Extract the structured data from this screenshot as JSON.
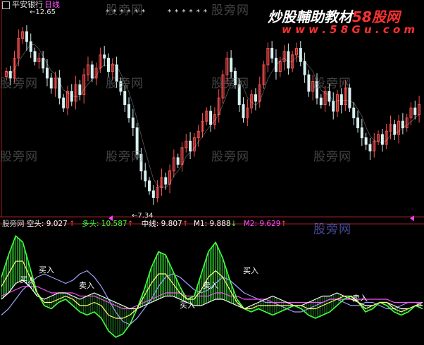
{
  "header": {
    "stock": "平安银行",
    "period": "日线",
    "high_label": "12.65",
    "low_label": "7.34",
    "stars": "* * * * * *"
  },
  "watermarks": {
    "text": "股旁网"
  },
  "branding": {
    "slogan": "炒股輔助教材",
    "site": "58股网",
    "url": "w w w . 5 8 G u . c o m"
  },
  "indicator": {
    "name": "股旁网",
    "kong_label": "空头:",
    "kong_value": "9.027",
    "duo_label": "多头:",
    "duo_value": "10.587",
    "mid_label": "中线:",
    "mid_value": "9.807",
    "m1_label": "M1:",
    "m1_value": "9.888",
    "m2_label": "M2:",
    "m2_value": "9.629",
    "signal_buy": "买入",
    "signal_sell": "卖入"
  },
  "colors": {
    "background": "#000000",
    "candle_up": "#ff5050",
    "candle_down": "#d8f0f0",
    "ma": "#ffffff",
    "kong": "#ffffff",
    "duo": "#40ff40",
    "mid": "#ffff80",
    "m1": "#a0a0ff",
    "m2": "#ff50ff",
    "duo_bar": "#40ff40",
    "axis": "#a02020"
  },
  "chart_data": [
    {
      "type": "candlestick",
      "title": "平安银行 日线",
      "annotations": [
        {
          "text": "12.65",
          "index": 3,
          "value": 12.65
        },
        {
          "text": "7.34",
          "index": 36,
          "value": 7.34
        }
      ],
      "ylim": [
        6.9,
        13.1
      ],
      "series": [
        {
          "values": [
            11.2,
            11.0,
            11.6,
            12.2,
            12.4,
            12.1,
            11.8,
            11.5,
            11.6,
            11.3,
            11.0,
            10.7,
            11.0,
            10.4,
            10.1,
            10.6,
            10.3,
            10.8,
            10.5,
            11.1,
            11.4,
            11.0,
            11.3,
            11.7,
            11.6,
            11.2,
            11.4,
            10.9,
            10.6,
            10.2,
            9.8,
            9.5,
            8.7,
            8.2,
            7.9,
            7.6,
            7.4,
            7.7,
            8.0,
            7.8,
            8.2,
            8.6,
            8.4,
            8.9,
            9.1,
            8.8,
            9.2,
            9.4,
            9.7,
            10.0,
            9.6,
            9.9,
            10.4,
            11.1,
            11.6,
            11.2,
            10.8,
            10.2,
            9.8,
            10.1,
            10.5,
            10.3,
            10.8,
            11.4,
            11.9,
            11.6,
            11.2,
            11.5,
            11.8,
            11.3,
            11.7,
            11.9,
            11.5,
            11.1,
            10.6,
            10.9,
            10.4,
            10.2,
            10.6,
            10.3,
            10.0,
            10.5,
            10.2,
            10.7,
            10.1,
            9.8,
            9.5,
            9.2,
            9.0,
            8.8,
            9.1,
            9.3,
            9.0,
            9.4,
            9.6,
            9.3,
            9.7,
            9.5,
            9.8,
            10.1,
            9.9,
            10.2
          ]
        }
      ]
    },
    {
      "type": "line",
      "ylim": [
        8.0,
        11.6
      ],
      "series": [
        {
          "name": "空头",
          "values": [
            9.4,
            9.6,
            9.9,
            10.0,
            9.8,
            9.5,
            9.4,
            9.5,
            9.6,
            9.6,
            9.5,
            9.4,
            9.5,
            9.6,
            9.5,
            9.4,
            9.3,
            9.2,
            9.1,
            9.1,
            9.2,
            9.3,
            9.4,
            9.5,
            9.5,
            9.4,
            9.3,
            9.2,
            9.2,
            9.3,
            9.4,
            9.4,
            9.3,
            9.2,
            9.1,
            9.2,
            9.3,
            9.4,
            9.5,
            9.4,
            9.3,
            9.2,
            9.2,
            9.3,
            9.4,
            9.5,
            9.5,
            9.6,
            9.5,
            9.4,
            9.3,
            9.2,
            9.2,
            9.3,
            9.3,
            9.2,
            9.1,
            9.1,
            9.2,
            9.3
          ]
        },
        {
          "name": "多头",
          "values": [
            10.1,
            10.8,
            11.4,
            11.2,
            10.4,
            9.6,
            9.2,
            9.1,
            9.3,
            9.4,
            9.2,
            9.0,
            8.9,
            9.0,
            8.8,
            8.4,
            8.2,
            8.3,
            8.6,
            9.1,
            9.7,
            10.4,
            10.9,
            10.8,
            10.3,
            9.8,
            9.4,
            9.5,
            10.2,
            10.9,
            11.2,
            10.7,
            10.0,
            9.4,
            9.1,
            9.0,
            9.1,
            9.0,
            8.9,
            9.0,
            9.1,
            9.2,
            9.1,
            8.9,
            8.8,
            8.9,
            9.0,
            9.2,
            9.4,
            9.5,
            9.3,
            9.0,
            9.1,
            9.3,
            9.2,
            9.0,
            8.9,
            9.0,
            9.2,
            9.1
          ]
        },
        {
          "name": "中线",
          "values": [
            9.8,
            10.2,
            10.6,
            10.6,
            10.1,
            9.6,
            9.3,
            9.3,
            9.4,
            9.5,
            9.4,
            9.2,
            9.2,
            9.3,
            9.2,
            8.9,
            8.8,
            8.8,
            8.9,
            9.1,
            9.5,
            9.9,
            10.2,
            10.2,
            9.9,
            9.6,
            9.4,
            9.4,
            9.7,
            10.1,
            10.3,
            10.1,
            9.7,
            9.3,
            9.1,
            9.1,
            9.2,
            9.2,
            9.2,
            9.2,
            9.2,
            9.2,
            9.2,
            9.1,
            9.1,
            9.2,
            9.3,
            9.4,
            9.5,
            9.5,
            9.3,
            9.1,
            9.2,
            9.3,
            9.3,
            9.1,
            9.0,
            9.1,
            9.2,
            9.2
          ]
        },
        {
          "name": "M1",
          "values": [
            8.9,
            9.1,
            9.4,
            9.7,
            9.9,
            10.1,
            10.2,
            10.1,
            10.0,
            9.9,
            10.0,
            10.2,
            10.3,
            10.1,
            9.8,
            9.4,
            9.0,
            8.7,
            8.6,
            8.8,
            9.1,
            9.4,
            9.8,
            10.1,
            10.2,
            10.1,
            9.9,
            9.7,
            9.6,
            9.7,
            9.9,
            10.1,
            10.0,
            9.8,
            9.6,
            9.5,
            9.4,
            9.3,
            9.3,
            9.2,
            9.1,
            9.0,
            9.0,
            9.1,
            9.2,
            9.3,
            9.4,
            9.4,
            9.3,
            9.2,
            9.2,
            9.3,
            9.3,
            9.2,
            9.1,
            9.1,
            9.2,
            9.3,
            9.3,
            9.2
          ]
        },
        {
          "name": "M2",
          "values": [
            9.5,
            9.6,
            9.7,
            9.8,
            9.8,
            9.8,
            9.7,
            9.6,
            9.6,
            9.6,
            9.6,
            9.5,
            9.5,
            9.5,
            9.4,
            9.3,
            9.2,
            9.1,
            9.1,
            9.2,
            9.3,
            9.4,
            9.5,
            9.6,
            9.6,
            9.6,
            9.5,
            9.5,
            9.5,
            9.5,
            9.6,
            9.6,
            9.5,
            9.5,
            9.4,
            9.4,
            9.4,
            9.4,
            9.3,
            9.3,
            9.3,
            9.3,
            9.3,
            9.3,
            9.3,
            9.3,
            9.4,
            9.4,
            9.4,
            9.4,
            9.4,
            9.4,
            9.4,
            9.4,
            9.4,
            9.3,
            9.3,
            9.3,
            9.3,
            9.3
          ]
        }
      ]
    }
  ]
}
